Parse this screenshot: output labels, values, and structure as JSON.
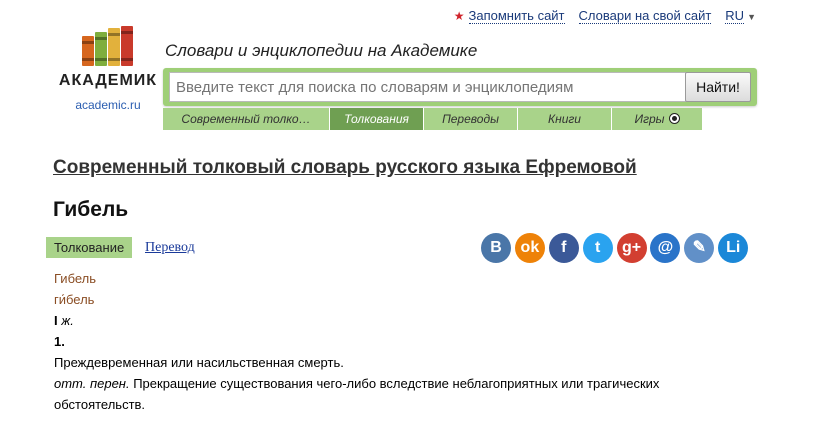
{
  "topnav": {
    "remember": "Запомнить сайт",
    "own_site": "Словари на свой сайт",
    "lang": "RU"
  },
  "logo": {
    "brand": "АКАДЕМИК",
    "site": "academic.ru"
  },
  "tagline": "Словари и энциклопедии на Академике",
  "search": {
    "placeholder": "Введите текст для поиска по словарям и энциклопедиям",
    "button": "Найти!"
  },
  "tabs": [
    {
      "label": "Современный толко…"
    },
    {
      "label": "Толкования"
    },
    {
      "label": "Переводы"
    },
    {
      "label": "Книги"
    },
    {
      "label": "Игры"
    }
  ],
  "dictionary_title": "Современный толковый словарь русского языка Ефремовой",
  "headword": "Гибель",
  "view": {
    "active": "Толкование",
    "other": "Перевод"
  },
  "share": [
    {
      "icon": "vk-icon",
      "glyph": "В",
      "color": "#4a76a8"
    },
    {
      "icon": "odnoklassniki-icon",
      "glyph": "ok",
      "color": "#ee8208"
    },
    {
      "icon": "facebook-icon",
      "glyph": "f",
      "color": "#3b5998"
    },
    {
      "icon": "twitter-icon",
      "glyph": "t",
      "color": "#2aa3ef"
    },
    {
      "icon": "google-plus-icon",
      "glyph": "g+",
      "color": "#d23f31"
    },
    {
      "icon": "mail-icon",
      "glyph": "@",
      "color": "#2a74c9"
    },
    {
      "icon": "livejournal-icon",
      "glyph": "✎",
      "color": "#6190c8"
    },
    {
      "icon": "liveinternet-icon",
      "glyph": "Li",
      "color": "#1b88d8"
    }
  ],
  "entry": {
    "line1": "Гибель",
    "line2": "ги́бель",
    "roman": "I",
    "gender": "ж.",
    "sense_num": "1.",
    "def1": "Преждевременная или насильственная смерть.",
    "note": "отт. перен.",
    "def2": "Прекращение существования чего-либо вследствие неблагоприятных или трагических обстоятельств."
  },
  "colors": {
    "tab_bg": "#a9d38a",
    "tab_active": "#6f9f52",
    "link": "#1a3a7a",
    "headword_link": "#8a4d23"
  }
}
